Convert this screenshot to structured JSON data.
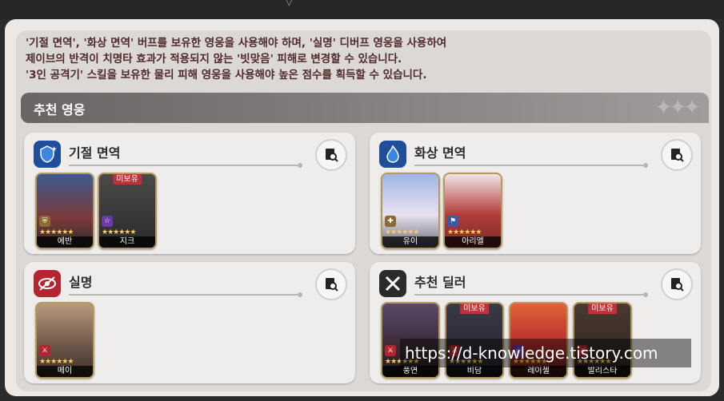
{
  "description": {
    "line1": "'기절 면역', '화상 면역' 버프를 보유한 영웅을 사용해야 하며, '실명' 디버프 영웅을 사용하여",
    "line2": "제이브의 반격이 치명타 효과가 적용되지 않는 '빗맞음' 피해로 변경할 수 있습니다.",
    "line3": "'3인 공격기' 스킬을 보유한 물리 피해 영웅을 사용해야 높은 점수를 획득할 수 있습니다."
  },
  "recommended": {
    "title": "추천 영웅",
    "stars": "✦✦✦"
  },
  "cards": {
    "stun": {
      "title": "기절 면역",
      "icon": "stun-immunity-icon",
      "heroes": [
        {
          "name": "에반",
          "badge": "",
          "class": "shield-class-icon",
          "stars": "★★★★★★"
        },
        {
          "name": "지크",
          "badge": "미보유",
          "class": "star-class-icon",
          "stars": "★★★★★★"
        }
      ]
    },
    "burn": {
      "title": "화상 면역",
      "icon": "burn-immunity-icon",
      "heroes": [
        {
          "name": "유이",
          "badge": "",
          "class": "healer-class-icon",
          "stars": "★★★★★★"
        },
        {
          "name": "아리엘",
          "badge": "",
          "class": "flag-class-icon",
          "stars": "★★★★★★"
        }
      ]
    },
    "blind": {
      "title": "실명",
      "icon": "blind-icon",
      "heroes": [
        {
          "name": "메이",
          "badge": "",
          "class": "warrior-class-icon",
          "stars": "★★★★★★"
        }
      ]
    },
    "dealer": {
      "title": "추천 딜러",
      "icon": "crossed-swords-icon",
      "heroes": [
        {
          "name": "풍연",
          "badge": "",
          "class": "warrior-class-icon",
          "stars": "★★★★★★"
        },
        {
          "name": "비담",
          "badge": "미보유",
          "class": "warrior-class-icon",
          "stars": "★★★★★★"
        },
        {
          "name": "레이첼",
          "badge": "",
          "class": "star-class-icon",
          "stars": "★★★★★★"
        },
        {
          "name": "발리스타",
          "badge": "미보유",
          "class": "warrior-class-icon",
          "stars": "★★★★★★"
        }
      ]
    }
  },
  "watermark": "https://d-knowledge.tistory.com",
  "colors": {
    "accent_text": "#4e2a2a",
    "badge_red": "#c0313a",
    "star_yellow": "#ffd23f",
    "header_grey": "#7a7574"
  }
}
